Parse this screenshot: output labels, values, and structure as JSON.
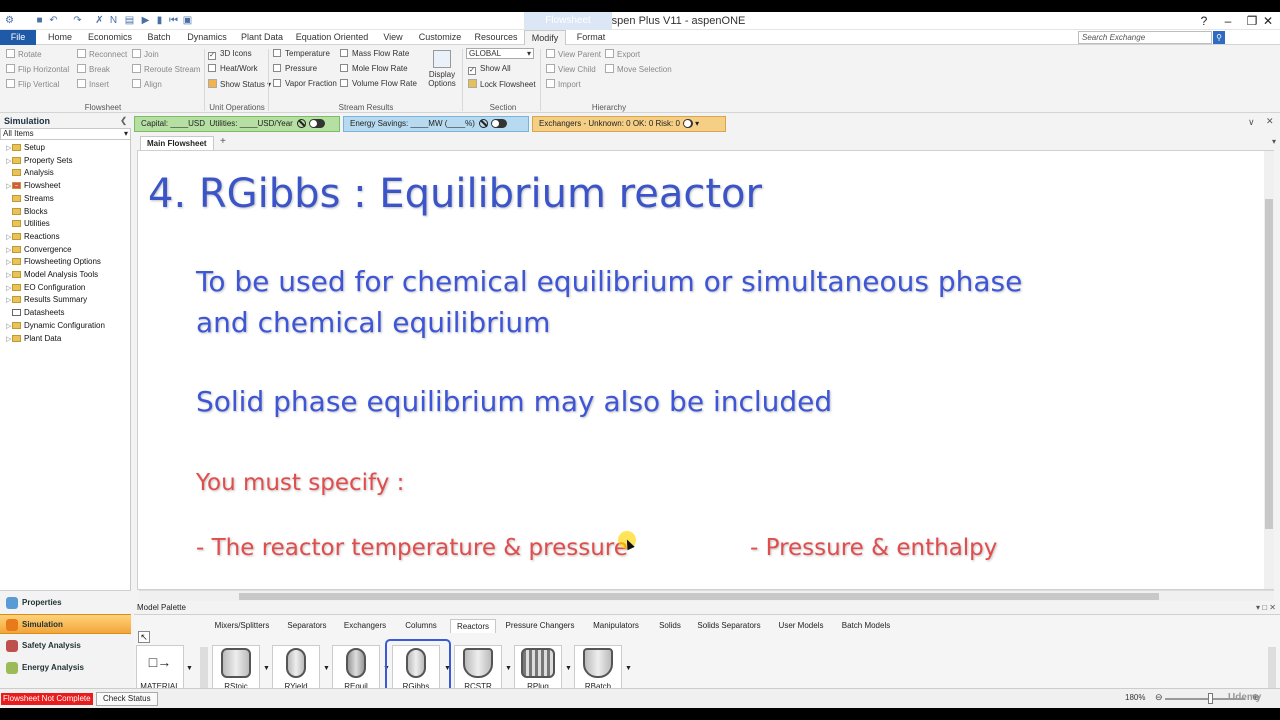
{
  "window": {
    "title": "Simulation 2 - Aspen Plus V11 - aspenONE",
    "context_tab": "Flowsheet",
    "controls": [
      "?",
      "–",
      "❐",
      "✕"
    ]
  },
  "ribbon_tabs": [
    "File",
    "Home",
    "Economics",
    "Batch",
    "Dynamics",
    "Plant Data",
    "Equation Oriented",
    "View",
    "Customize",
    "Resources",
    "Modify",
    "Format"
  ],
  "search": {
    "placeholder": "Search Exchange"
  },
  "ribbon": {
    "flowsheet": {
      "rotate": "Rotate",
      "flip_h": "Flip Horizontal",
      "flip_v": "Flip Vertical",
      "reconnect": "Reconnect",
      "break": "Break",
      "insert": "Insert",
      "join": "Join",
      "reroute": "Reroute Stream",
      "align": "Align",
      "label": "Flowsheet"
    },
    "unit_ops": {
      "icons3d": "3D Icons",
      "heatwork": "Heat/Work",
      "show_status": "Show Status",
      "label": "Unit Operations"
    },
    "stream_results": {
      "temperature": "Temperature",
      "pressure": "Pressure",
      "vapor_fraction": "Vapor Fraction",
      "mass_flow": "Mass Flow Rate",
      "mole_flow": "Mole Flow Rate",
      "vol_flow": "Volume Flow Rate",
      "label": "Stream Results"
    },
    "display_options": "Display Options",
    "section": {
      "global": "GLOBAL",
      "show_all": "Show All",
      "lock": "Lock Flowsheet",
      "label": "Section"
    },
    "hierarchy": {
      "view_parent": "View Parent",
      "view_child": "View Child",
      "import": "Import",
      "export": "Export",
      "move_selection": "Move Selection",
      "label": "Hierarchy"
    }
  },
  "nav": {
    "header": "Simulation",
    "filter": "All Items",
    "items": [
      "Setup",
      "Property Sets",
      "Analysis",
      "Flowsheet",
      "Streams",
      "Blocks",
      "Utilities",
      "Reactions",
      "Convergence",
      "Flowsheeting Options",
      "Model Analysis Tools",
      "EO Configuration",
      "Results Summary",
      "Datasheets",
      "Dynamic Configuration",
      "Plant Data"
    ],
    "buttons": [
      "Properties",
      "Simulation",
      "Safety Analysis",
      "Energy Analysis"
    ]
  },
  "costing": {
    "capital": "Capital: ____USD",
    "utilities": "Utilities: ____USD/Year",
    "energy": "Energy Savings: ____MW  (____%)",
    "exchangers": "Exchangers - Unknown: 0  OK: 0  Risk: 0"
  },
  "flowsheet_tab": "Main Flowsheet",
  "slide": {
    "title": "4. RGibbs : Equilibrium reactor",
    "line1": "To be used for chemical equilibrium or simultaneous phase",
    "line2": "and chemical equilibrium",
    "line3": "Solid phase equilibrium may also be included",
    "must": "You must specify :",
    "opt1": "- The reactor temperature & pressure",
    "opt2": "- Pressure & enthalpy"
  },
  "palette": {
    "header": "Model Palette",
    "tabs": [
      "Mixers/Splitters",
      "Separators",
      "Exchangers",
      "Columns",
      "Reactors",
      "Pressure Changers",
      "Manipulators",
      "Solids",
      "Solids Separators",
      "User Models",
      "Batch Models"
    ],
    "material": "MATERIAL",
    "blocks": [
      "RStoic",
      "RYield",
      "REquil",
      "RGibbs",
      "RCSTR",
      "RPlug",
      "RBatch"
    ]
  },
  "status": {
    "error": "Flowsheet Not Complete",
    "check": "Check Status",
    "zoom": "180%",
    "watermark": "Udemy"
  }
}
